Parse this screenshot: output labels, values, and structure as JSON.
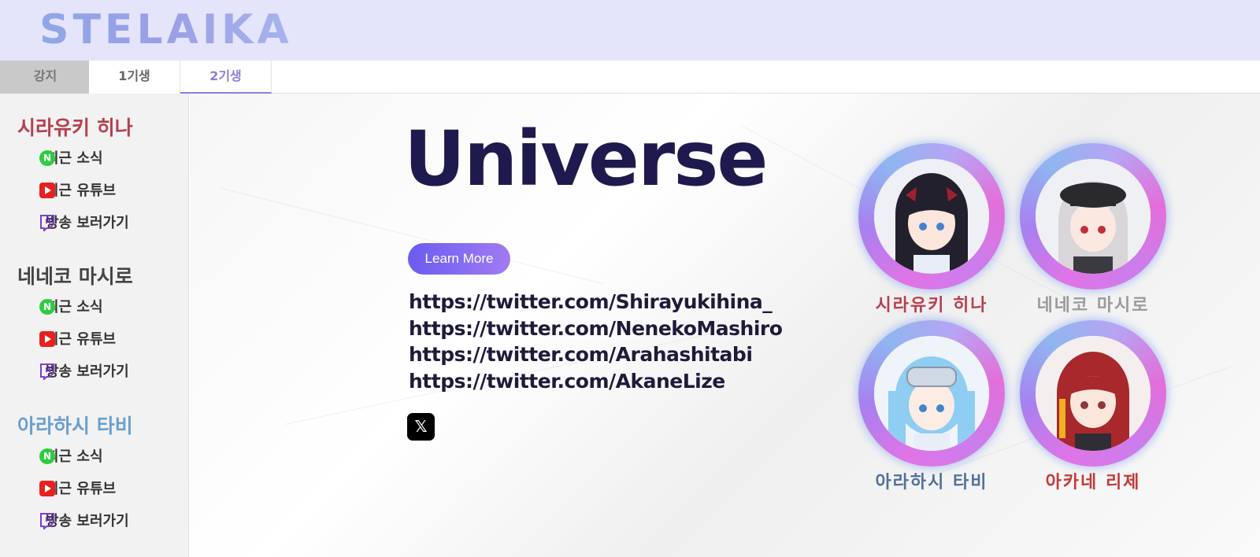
{
  "header": {
    "logo": "STELAIKA"
  },
  "tabs": [
    {
      "label": "강지"
    },
    {
      "label": "1기생"
    },
    {
      "label": "2기생"
    }
  ],
  "sidebar": {
    "members": [
      {
        "name": "시라유키 히나",
        "color": "#b5404f",
        "links": [
          {
            "label": "최근 소식"
          },
          {
            "label": "최근 유튜브"
          },
          {
            "label": "방송 보러가기"
          }
        ]
      },
      {
        "name": "네네코 마시로",
        "color": "#444444",
        "links": [
          {
            "label": "최근 소식"
          },
          {
            "label": "최근 유튜브"
          },
          {
            "label": "방송 보러가기"
          }
        ]
      },
      {
        "name": "아라하시 타비",
        "color": "#6aa0cc",
        "links": [
          {
            "label": "최근 소식"
          },
          {
            "label": "최근 유튜브"
          },
          {
            "label": "방송 보러가기"
          }
        ]
      }
    ],
    "icons": {
      "news": "naver-icon",
      "youtube": "youtube-icon",
      "stream": "twitch-icon"
    }
  },
  "main": {
    "headline": "Universe",
    "learn_more": "Learn More",
    "urls": [
      "https://twitter.com/Shirayukihina_",
      "https://twitter.com/NenekoMashiro",
      "https://twitter.com/Arahashitabi",
      "https://twitter.com/AkaneLize"
    ],
    "x_icon": "x-logo-icon",
    "avatars": [
      {
        "name": "시라유키 히나",
        "color": "#b5404f",
        "hair": "#23202e",
        "accent": "#a02030"
      },
      {
        "name": "네네코 마시로",
        "color": "#9a9a9a",
        "hair": "#d9d6d9",
        "accent": "#2a2a2e"
      },
      {
        "name": "아라하시 타비",
        "color": "#50709a",
        "hair": "#8fcdf2",
        "accent": "#d0d8e4"
      },
      {
        "name": "아카네 리제",
        "color": "#c23b3b",
        "hair": "#a8282c",
        "accent": "#f0b020"
      }
    ]
  }
}
